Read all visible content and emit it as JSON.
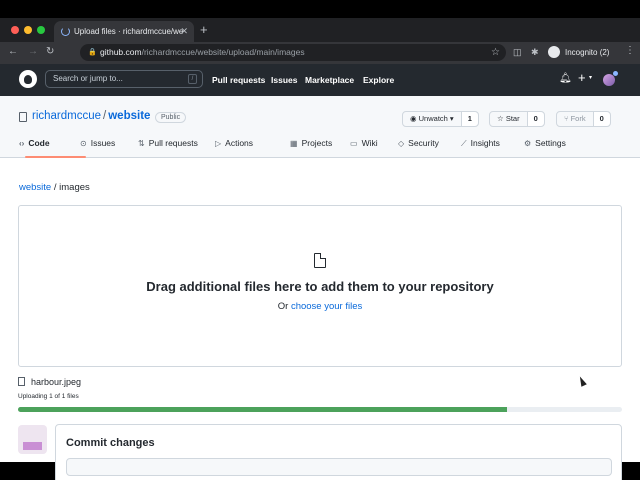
{
  "browser": {
    "tab_title": "Upload files · richardmccue/we",
    "new_tab_symbol": "+",
    "url_host": "github.com",
    "url_path": "/richardmccue/website/upload/main/images",
    "profile": "Incognito (2)"
  },
  "header": {
    "search_placeholder": "Search or jump to...",
    "search_shortcut": "/",
    "nav": [
      "Pull requests",
      "Issues",
      "Marketplace",
      "Explore"
    ]
  },
  "repo": {
    "owner": "richardmccue",
    "separator": "/",
    "name": "website",
    "visibility": "Public",
    "watch_label": "Unwatch",
    "watch_count": "1",
    "star_label": "Star",
    "star_count": "0",
    "fork_label": "Fork",
    "fork_count": "0"
  },
  "tabs": [
    {
      "label": "Code",
      "icon": "code-icon"
    },
    {
      "label": "Issues",
      "icon": "issue-icon"
    },
    {
      "label": "Pull requests",
      "icon": "pull-request-icon"
    },
    {
      "label": "Actions",
      "icon": "play-icon"
    },
    {
      "label": "Projects",
      "icon": "table-icon"
    },
    {
      "label": "Wiki",
      "icon": "book-icon"
    },
    {
      "label": "Security",
      "icon": "shield-icon"
    },
    {
      "label": "Insights",
      "icon": "graph-icon"
    },
    {
      "label": "Settings",
      "icon": "gear-icon"
    }
  ],
  "breadcrumb": {
    "repo": "website",
    "separator": "/",
    "folder": "images"
  },
  "dropzone": {
    "title": "Drag additional files here to add them to your repository",
    "or_text": "Or",
    "choose_link": "choose your files"
  },
  "upload": {
    "file_name": "harbour.jpeg",
    "status": "Uploading 1 of 1 files",
    "progress_fraction": 0.81
  },
  "commit": {
    "title": "Commit changes"
  },
  "colors": {
    "progress_fill": "#4ca25b",
    "link": "#0969da",
    "active_tab_underline": "#fd8c73"
  }
}
